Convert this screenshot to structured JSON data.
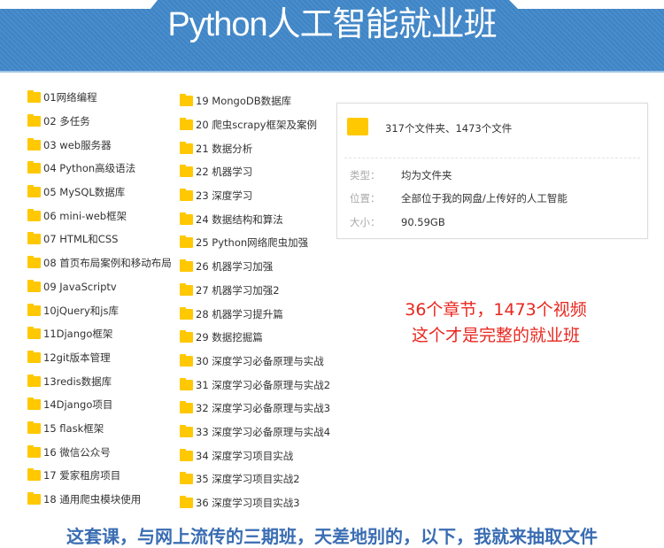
{
  "banner": {
    "title": "Python人工智能就业班"
  },
  "left_folders": [
    "01网络编程",
    "02 多任务",
    "03 web服务器",
    "04 Python高级语法",
    "05 MySQL数据库",
    "06 mini-web框架",
    "07 HTML和CSS",
    "08 首页布局案例和移动布局",
    "09 JavaScriptv",
    "10jQuery和js库",
    "11Django框架",
    "12git版本管理",
    "13redis数据库",
    "14Django项目",
    "15 flask框架",
    "16 微信公众号",
    "17 爱家租房项目",
    "18 通用爬虫模块使用"
  ],
  "right_folders": [
    "19 MongoDB数据库",
    "20 爬虫scrapy框架及案例",
    "21 数据分析",
    "22 机器学习",
    "23 深度学习",
    "24 数据结构和算法",
    "25 Python网络爬虫加强",
    "26 机器学习加强",
    "27 机器学习加强2",
    "28 机器学习提升篇",
    "29 数据挖掘篇",
    "30 深度学习必备原理与实战",
    "31 深度学习必备原理与实战2",
    "32 深度学习必备原理与实战3",
    "33 深度学习必备原理与实战4",
    "34 深度学习项目实战",
    "35 深度学习项目实战2",
    "36 深度学习项目实战3"
  ],
  "info": {
    "summary": "317个文件夹、1473个文件",
    "type_label": "类型：",
    "type_value": "均为文件夹",
    "location_label": "位置：",
    "location_value": "全部位于我的网盘/上传好的人工智能",
    "size_label": "大小：",
    "size_value": "90.59GB"
  },
  "highlight": {
    "line1": "36个章节，1473个视频",
    "line2": "这个才是完整的就业班"
  },
  "footer": "这套课，与网上流传的三期班，天差地别的，以下，我就来抽取文件"
}
